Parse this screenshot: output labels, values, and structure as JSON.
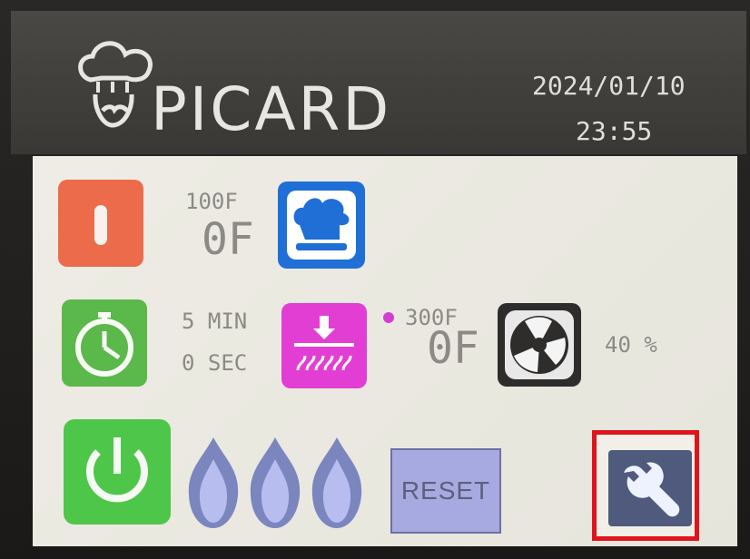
{
  "header": {
    "brand": "PICARD",
    "date": "2024/01/10",
    "time": "23:55"
  },
  "temperature": {
    "setpoint": "100F",
    "current": "0F"
  },
  "timer": {
    "minutes": "5 MIN",
    "seconds": "0 SEC"
  },
  "heat": {
    "setpoint": "300F",
    "current": "0F"
  },
  "fan": {
    "speed": "40 %"
  },
  "buttons": {
    "reset": "RESET"
  },
  "icons": {
    "logo": "chef-logo-icon",
    "temperature": "thermometer-icon",
    "timer": "stopwatch-icon",
    "chef": "chef-hat-icon",
    "heat": "heating-element-icon",
    "fan": "fan-icon",
    "power": "power-icon",
    "flame": "flame-icon",
    "settings": "wrench-icon"
  },
  "colors": {
    "temperature_button": "#ec6b4a",
    "timer_button": "#5bb84a",
    "chef_button": "#1f6fd6",
    "heat_button": "#e33ed4",
    "fan_button": "#2e2d2b",
    "power_button": "#4ec64a",
    "reset_button": "#a7aae0",
    "settings_button": "#4f5a7d",
    "highlight_box": "#e0141b"
  }
}
